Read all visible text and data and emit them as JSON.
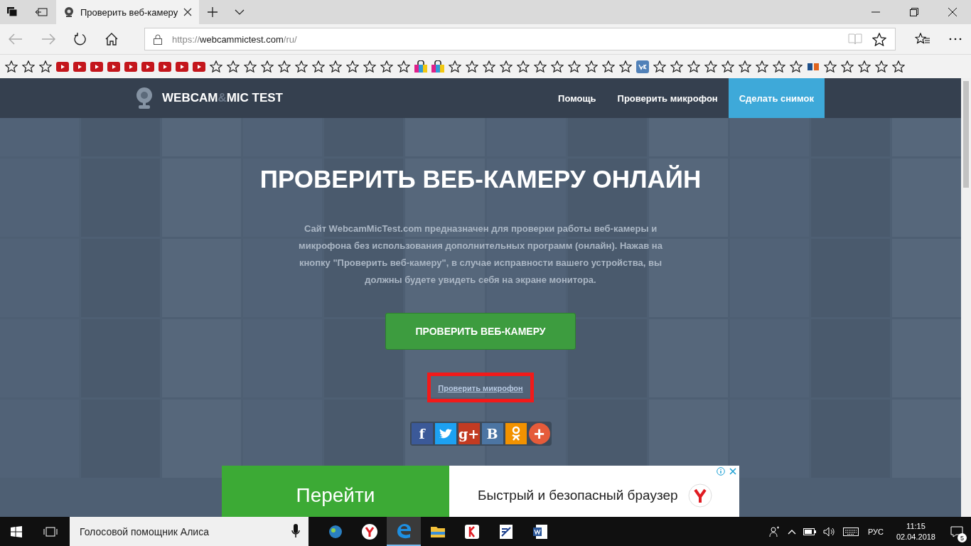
{
  "browser": {
    "tab": {
      "title": "Проверить веб-камеру",
      "selected": true
    },
    "address": {
      "scheme": "https://",
      "host": "webcammictest.com",
      "path": "/ru/"
    },
    "favorites": [
      {
        "kind": "star"
      },
      {
        "kind": "star"
      },
      {
        "kind": "star"
      },
      {
        "kind": "video"
      },
      {
        "kind": "video"
      },
      {
        "kind": "video"
      },
      {
        "kind": "video"
      },
      {
        "kind": "video"
      },
      {
        "kind": "video"
      },
      {
        "kind": "video"
      },
      {
        "kind": "video"
      },
      {
        "kind": "video"
      },
      {
        "kind": "star"
      },
      {
        "kind": "star"
      },
      {
        "kind": "star"
      },
      {
        "kind": "star"
      },
      {
        "kind": "star"
      },
      {
        "kind": "star"
      },
      {
        "kind": "star"
      },
      {
        "kind": "star"
      },
      {
        "kind": "star"
      },
      {
        "kind": "star"
      },
      {
        "kind": "star"
      },
      {
        "kind": "star"
      },
      {
        "kind": "bag"
      },
      {
        "kind": "bag"
      },
      {
        "kind": "star"
      },
      {
        "kind": "star"
      },
      {
        "kind": "star"
      },
      {
        "kind": "star"
      },
      {
        "kind": "star"
      },
      {
        "kind": "star"
      },
      {
        "kind": "star"
      },
      {
        "kind": "star"
      },
      {
        "kind": "star"
      },
      {
        "kind": "star"
      },
      {
        "kind": "star"
      },
      {
        "kind": "social"
      },
      {
        "kind": "star"
      },
      {
        "kind": "star"
      },
      {
        "kind": "star"
      },
      {
        "kind": "star"
      },
      {
        "kind": "star"
      },
      {
        "kind": "star"
      },
      {
        "kind": "star"
      },
      {
        "kind": "star"
      },
      {
        "kind": "star"
      },
      {
        "kind": "site"
      },
      {
        "kind": "star"
      },
      {
        "kind": "star"
      },
      {
        "kind": "star"
      },
      {
        "kind": "star"
      },
      {
        "kind": "star"
      }
    ]
  },
  "site": {
    "logo": {
      "part1": "WEBCAM",
      "amp": "&",
      "part2": "MIC TEST"
    },
    "nav": [
      {
        "label": "Помощь",
        "selected": false
      },
      {
        "label": "Проверить микрофон",
        "selected": false
      },
      {
        "label": "Сделать снимок",
        "selected": true
      }
    ],
    "hero": {
      "title": "ПРОВЕРИТЬ ВЕБ-КАМЕРУ ОНЛАЙН",
      "description": "Сайт WebcamMicTest.com предназначен для проверки работы веб-камеры и микрофона без использования дополнительных программ (онлайн). Нажав на кнопку \"Проверить веб-камеру\", в случае исправности вашего устройства, вы должны будете увидеть себя на экране монитора.",
      "button": "ПРОВЕРИТЬ ВЕБ-КАМЕРУ",
      "link": "Проверить микрофон",
      "share": [
        {
          "kind": "text",
          "glyph": "f",
          "color": "#3b5998"
        },
        {
          "kind": "bird",
          "color": "#1da1f2"
        },
        {
          "kind": "text",
          "glyph": "g+",
          "color": "#c23b22"
        },
        {
          "kind": "text",
          "glyph": "B",
          "color": "#4c75a3"
        },
        {
          "kind": "person",
          "color": "#f29200"
        },
        {
          "kind": "round",
          "glyph": "+",
          "color": "#e55b3a"
        }
      ]
    },
    "ad": {
      "action": "Перейти",
      "text": "Быстрый и безопасный браузер"
    }
  },
  "taskbar": {
    "search_placeholder": "Голосовой помощник Алиса",
    "apps": [
      {
        "kind": "game",
        "selected": false
      },
      {
        "kind": "yandex",
        "selected": false
      },
      {
        "kind": "edge",
        "selected": true
      },
      {
        "kind": "folder",
        "selected": false
      },
      {
        "kind": "yabrowser",
        "selected": false
      },
      {
        "kind": "doc",
        "selected": false
      },
      {
        "kind": "word",
        "selected": false
      }
    ],
    "language": "РУС",
    "time": "11:15",
    "date": "02.04.2018",
    "notifications": "5"
  }
}
